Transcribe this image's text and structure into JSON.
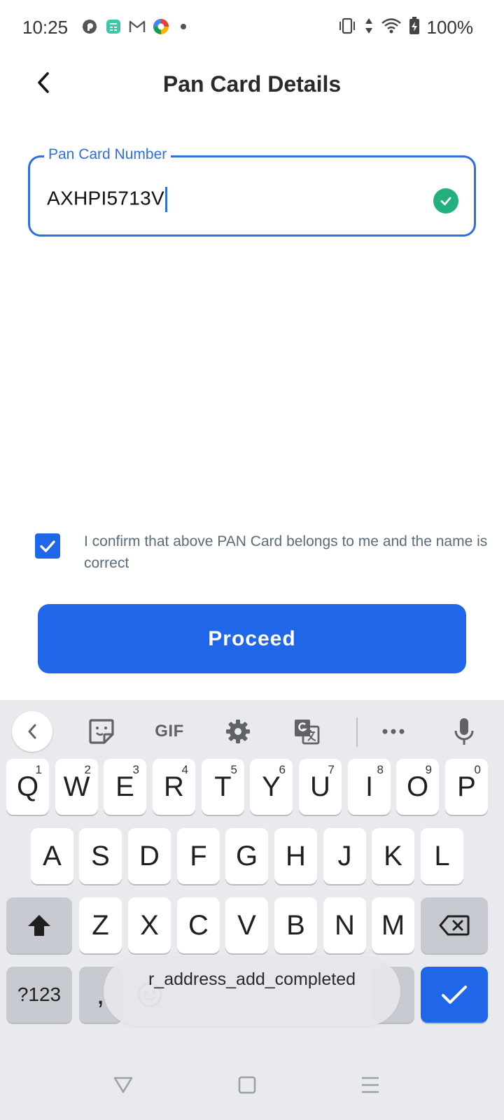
{
  "status_bar": {
    "time": "10:25",
    "battery": "100%",
    "notification_icons": [
      "circle-p-icon",
      "calculator-app-icon",
      "gmail-icon",
      "colorful-app-icon"
    ],
    "system_icons": [
      "vibrate-icon",
      "data-arrows-icon",
      "wifi-icon",
      "battery-charging-icon"
    ]
  },
  "header": {
    "title": "Pan Card Details"
  },
  "pan_field": {
    "label": "Pan Card Number",
    "value": "AXHPI5713V",
    "valid": true
  },
  "consent": {
    "checked": true,
    "text": "I confirm that above PAN Card belongs to me and the name is correct"
  },
  "proceed_button": {
    "label": "Proceed"
  },
  "colors": {
    "primary": "#1f66e8",
    "field_border": "#2f6fe0",
    "success": "#22b07d",
    "consent_text": "#5a6b7a",
    "keyboard_bg": "#e8eaed"
  },
  "keyboard": {
    "toolbar": {
      "gif_label": "GIF"
    },
    "row1": [
      {
        "key": "Q",
        "hint": "1"
      },
      {
        "key": "W",
        "hint": "2"
      },
      {
        "key": "E",
        "hint": "3"
      },
      {
        "key": "R",
        "hint": "4"
      },
      {
        "key": "T",
        "hint": "5"
      },
      {
        "key": "Y",
        "hint": "6"
      },
      {
        "key": "U",
        "hint": "7"
      },
      {
        "key": "I",
        "hint": "8"
      },
      {
        "key": "O",
        "hint": "9"
      },
      {
        "key": "P",
        "hint": "0"
      }
    ],
    "row2": [
      "A",
      "S",
      "D",
      "F",
      "G",
      "H",
      "J",
      "K",
      "L"
    ],
    "row3": [
      "Z",
      "X",
      "C",
      "V",
      "B",
      "N",
      "M"
    ],
    "symbols_label": "?123",
    "comma": ",",
    "period": "."
  },
  "toast": {
    "message": "r_address_add_completed"
  }
}
